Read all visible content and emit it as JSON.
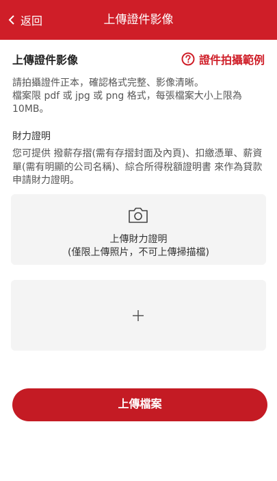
{
  "nav": {
    "back_label": "返回",
    "title": "上傳證件影像"
  },
  "section": {
    "title": "上傳證件影像",
    "example_link": "證件拍攝範例",
    "description": "請拍攝證件正本，確認格式完整、影像清晰。\n檔案限 pdf 或 jpg 或 png 格式，每張檔案大小上限為 10MB。"
  },
  "financial": {
    "title": "財力證明",
    "description": "您可提供 撥薪存摺(需有存摺封面及內頁)、扣繳憑單、薪資單(需有明顯的公司名稱)、綜合所得稅額證明書 來作為貸款申請財力證明。"
  },
  "upload_primary": {
    "label": "上傳財力證明",
    "note": "(僅限上傳照片，不可上傳掃描檔)"
  },
  "submit_label": "上傳檔案",
  "colors": {
    "brand_red": "#cf1e28",
    "button_red": "#c41b24",
    "box_gray": "#f4f4f4"
  },
  "icons": {
    "back": "chevron-left-icon",
    "help": "question-circle-icon",
    "camera": "camera-icon",
    "add": "plus-icon"
  }
}
